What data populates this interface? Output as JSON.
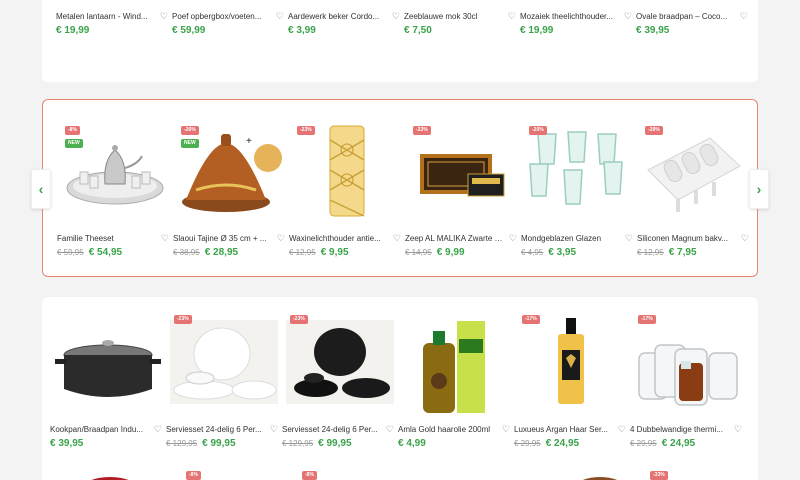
{
  "colors": {
    "accent": "#3aa34a",
    "discount": "#e57373",
    "new": "#4caf50",
    "highlight_border": "#e98477"
  },
  "sections": {
    "top": {
      "products": [
        {
          "name": "Metalen lantaarn - Wind...",
          "price": "€ 19,99",
          "old_price": "",
          "discount": "",
          "is_new": false,
          "icon": "lantern-image"
        },
        {
          "name": "Poef opbergbox/voeten...",
          "price": "€ 59,99",
          "old_price": "",
          "discount": "",
          "is_new": false,
          "icon": "pouf-image"
        },
        {
          "name": "Aardewerk beker Cordo...",
          "price": "€ 3,99",
          "old_price": "",
          "discount": "",
          "is_new": false,
          "icon": "mug-image"
        },
        {
          "name": "Zeeblauwe mok 30cl",
          "price": "€ 7,50",
          "old_price": "",
          "discount": "",
          "is_new": false,
          "icon": "mug-image"
        },
        {
          "name": "Mozaiek theelichthouder...",
          "price": "€ 19,99",
          "old_price": "",
          "discount": "",
          "is_new": false,
          "icon": "tealight-image"
        },
        {
          "name": "Ovale braadpan – Coco...",
          "price": "€ 39,95",
          "old_price": "",
          "discount": "",
          "is_new": false,
          "icon": "pan-image"
        }
      ]
    },
    "featured": {
      "products": [
        {
          "name": "Familie Theeset",
          "price": "€ 54,95",
          "old_price": "€ 59,95",
          "discount": "-8%",
          "is_new": true,
          "icon": "teaset-image"
        },
        {
          "name": "Slaoui Tajine Ø 35 cm + ...",
          "price": "€ 28,95",
          "old_price": "€ 38,95",
          "discount": "-26%",
          "is_new": true,
          "icon": "tajine-image"
        },
        {
          "name": "Waxinelichthouder antie...",
          "price": "€ 9,95",
          "old_price": "€ 12,95",
          "discount": "-23%",
          "is_new": false,
          "icon": "candleholder-image"
        },
        {
          "name": "Zeep AL MALIKA Zwarte Z...",
          "price": "€ 9,99",
          "old_price": "€ 14,95",
          "discount": "-33%",
          "is_new": false,
          "icon": "soap-image"
        },
        {
          "name": "Mondgeblazen Glazen",
          "price": "€ 3,95",
          "old_price": "€ 4,95",
          "discount": "-20%",
          "is_new": false,
          "icon": "glasses-image"
        },
        {
          "name": "Siliconen Magnum bakv...",
          "price": "€ 7,95",
          "old_price": "€ 12,95",
          "discount": "-39%",
          "is_new": false,
          "icon": "mold-image"
        }
      ]
    },
    "bottom": {
      "products": [
        {
          "name": "Kookpan/Braadpan Indu...",
          "price": "€ 39,95",
          "old_price": "",
          "discount": "",
          "is_new": false,
          "icon": "cookpot-image"
        },
        {
          "name": "Serviesset 24-delig 6 Per...",
          "price": "€ 99,95",
          "old_price": "€ 129,95",
          "discount": "-23%",
          "is_new": false,
          "icon": "dinnerset-white-image"
        },
        {
          "name": "Serviesset 24-delig 6 Per...",
          "price": "€ 99,95",
          "old_price": "€ 129,95",
          "discount": "-23%",
          "is_new": false,
          "icon": "dinnerset-black-image"
        },
        {
          "name": "Amla Gold haarolie 200ml",
          "price": "€ 4,99",
          "old_price": "",
          "discount": "",
          "is_new": false,
          "icon": "hairoil-image"
        },
        {
          "name": "Luxueus Argan Haar Ser...",
          "price": "€ 24,95",
          "old_price": "€ 29,95",
          "discount": "-17%",
          "is_new": false,
          "icon": "serum-image"
        },
        {
          "name": "4 Dubbelwandige thermi...",
          "price": "€ 24,95",
          "old_price": "€ 29,95",
          "discount": "-17%",
          "is_new": false,
          "icon": "thermoglass-image"
        }
      ]
    },
    "peek": {
      "badges": [
        "-8%",
        "-8%",
        "-33%"
      ]
    }
  },
  "ui": {
    "new_label": "NEW",
    "prev_arrow": "‹",
    "next_arrow": "›",
    "heart": "♡"
  }
}
